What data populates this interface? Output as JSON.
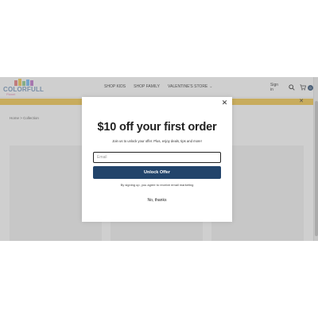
{
  "header": {
    "logo_text": "COLORFULL",
    "logo_subtext": "Planet",
    "nav": [
      {
        "label": "SHOP KIDS",
        "has_dropdown": false
      },
      {
        "label": "SHOP FAMILY",
        "has_dropdown": false
      },
      {
        "label": "VALENTINE'S STORE",
        "has_dropdown": true
      }
    ],
    "signin_label": "Sign in",
    "cart_count": "0",
    "icons": {
      "search": "search-icon",
      "cart": "cart-icon",
      "dropdown": "chevron-down-icon"
    }
  },
  "promo_bar": {
    "close_label": "✕",
    "color": "#f3c33c"
  },
  "breadcrumb": "Home > Collection",
  "popup": {
    "close_label": "✕",
    "title": "$10 off your first order",
    "subtitle": "Join us to unlock your offer. Plus, enjoy deals, tips and more!",
    "email_placeholder": "Email",
    "email_value": "",
    "submit_label": "Unlock Offer",
    "disclaimer": "By signing up, you agree to receive email marketing",
    "dismiss_label": "No, thanks",
    "button_color": "#22446b"
  }
}
